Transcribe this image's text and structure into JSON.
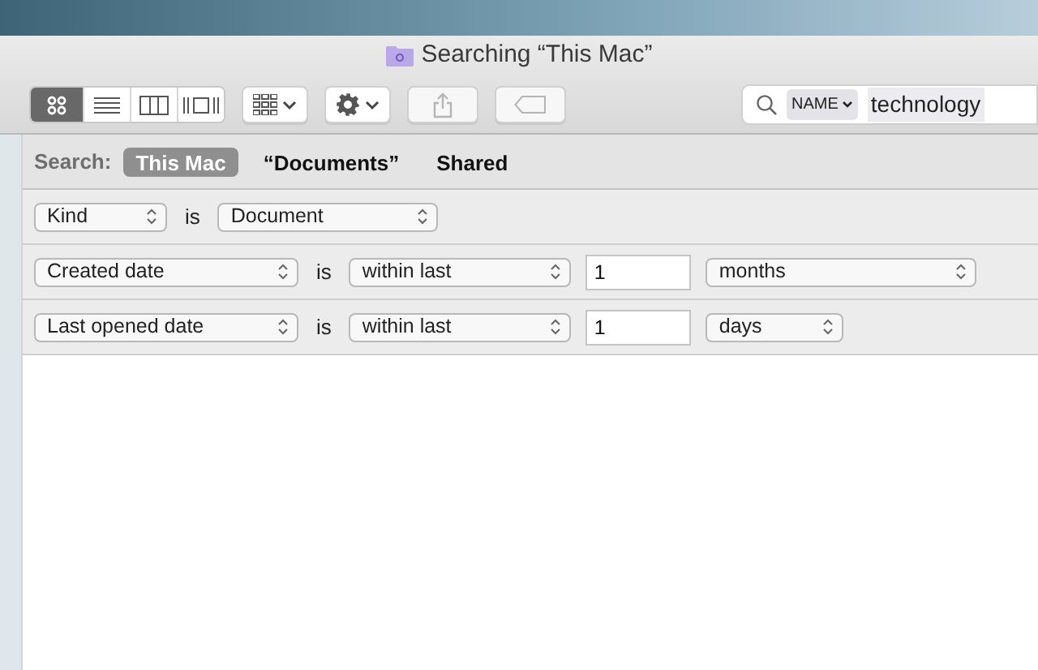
{
  "window": {
    "title": "Searching “This Mac”"
  },
  "toolbar": {
    "view_modes": [
      {
        "kind": "icons",
        "selected": true
      },
      {
        "kind": "list",
        "selected": false
      },
      {
        "kind": "columns",
        "selected": false
      },
      {
        "kind": "gallery",
        "selected": false
      }
    ],
    "buttons": [
      {
        "kind": "arrange",
        "disabled": false
      },
      {
        "kind": "action",
        "disabled": false
      },
      {
        "kind": "share",
        "disabled": true
      },
      {
        "kind": "tag",
        "disabled": true
      }
    ],
    "search": {
      "token": "NAME",
      "value": "technology"
    }
  },
  "scope_bar": {
    "label": "Search:",
    "scopes": [
      {
        "label": "This Mac",
        "selected": true
      },
      {
        "label": "“Documents”",
        "selected": false
      },
      {
        "label": "Shared",
        "selected": false
      }
    ]
  },
  "criteria": [
    {
      "items": [
        {
          "kind": "popup",
          "label": "Kind"
        },
        {
          "kind": "text",
          "label": "is"
        },
        {
          "kind": "popup",
          "label": "Document"
        }
      ]
    },
    {
      "items": [
        {
          "kind": "popup",
          "label": "Created date"
        },
        {
          "kind": "text",
          "label": "is"
        },
        {
          "kind": "popup",
          "label": "within last"
        },
        {
          "kind": "field",
          "value": "1"
        },
        {
          "kind": "popup",
          "label": "months"
        }
      ]
    },
    {
      "items": [
        {
          "kind": "popup",
          "label": "Last opened date"
        },
        {
          "kind": "text",
          "label": "is"
        },
        {
          "kind": "popup",
          "label": "within last"
        },
        {
          "kind": "field",
          "value": "1"
        },
        {
          "kind": "popup",
          "label": "days"
        }
      ]
    }
  ]
}
